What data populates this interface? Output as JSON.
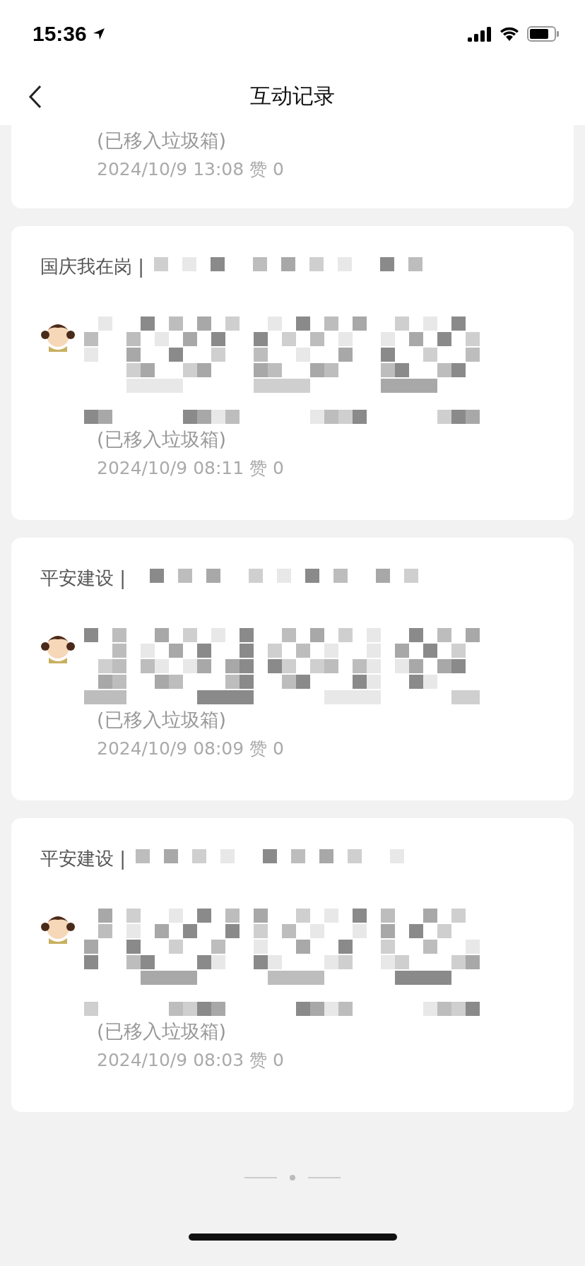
{
  "status_bar": {
    "time": "15:36"
  },
  "nav": {
    "title": "互动记录"
  },
  "records": [
    {
      "removed": "(已移入垃圾箱)",
      "meta": "2024/10/9 13:08 赞 0"
    },
    {
      "title": "国庆我在岗 |",
      "removed": "(已移入垃圾箱)",
      "meta": "2024/10/9 08:11 赞 0"
    },
    {
      "title": "平安建设 |",
      "removed": "(已移入垃圾箱)",
      "meta": "2024/10/9 08:09 赞 0"
    },
    {
      "title": "平安建设 |",
      "removed": "(已移入垃圾箱)",
      "meta": "2024/10/9 08:03 赞 0"
    }
  ]
}
